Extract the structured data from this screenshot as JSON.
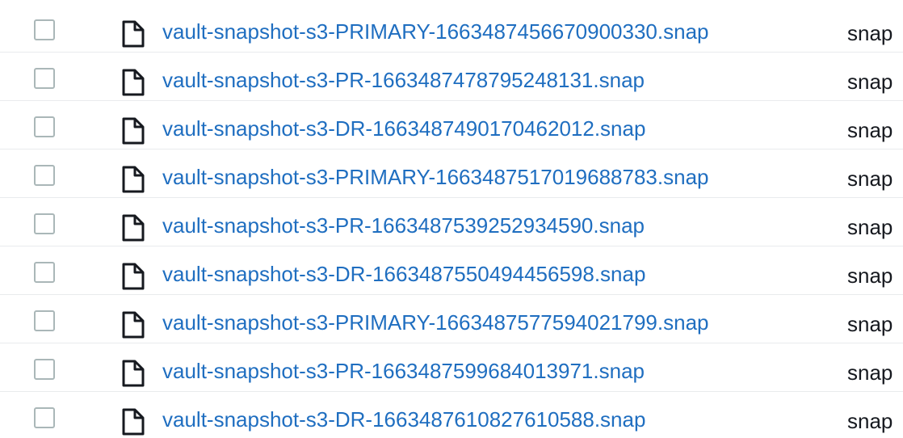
{
  "table": {
    "rows": [
      {
        "name": "vault-snapshot-s3-PRIMARY-1663487456670900330.snap",
        "type": "snap"
      },
      {
        "name": "vault-snapshot-s3-PR-1663487478795248131.snap",
        "type": "snap"
      },
      {
        "name": "vault-snapshot-s3-DR-1663487490170462012.snap",
        "type": "snap"
      },
      {
        "name": "vault-snapshot-s3-PRIMARY-1663487517019688783.snap",
        "type": "snap"
      },
      {
        "name": "vault-snapshot-s3-PR-1663487539252934590.snap",
        "type": "snap"
      },
      {
        "name": "vault-snapshot-s3-DR-1663487550494456598.snap",
        "type": "snap"
      },
      {
        "name": "vault-snapshot-s3-PRIMARY-1663487577594021799.snap",
        "type": "snap"
      },
      {
        "name": "vault-snapshot-s3-PR-1663487599684013971.snap",
        "type": "snap"
      },
      {
        "name": "vault-snapshot-s3-DR-1663487610827610588.snap",
        "type": "snap"
      }
    ],
    "icon": "file-icon",
    "colors": {
      "link": "#1f6ec0",
      "text": "#16191f",
      "checkbox_border": "#aab7b8",
      "row_divider": "#e9ebed"
    }
  }
}
